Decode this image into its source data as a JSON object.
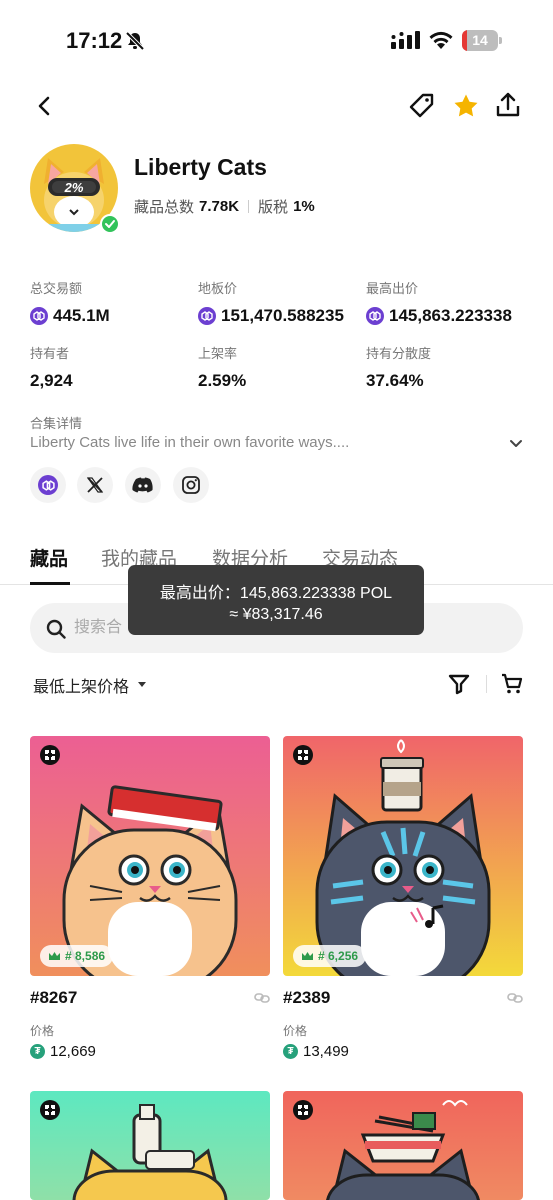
{
  "status_bar": {
    "time": "17:12",
    "battery": "14",
    "battery_level": 0.14
  },
  "collection": {
    "name": "Liberty Cats",
    "items_label": "藏品总数",
    "items_value": "7.78K",
    "royalty_label": "版税",
    "royalty_value": "1%",
    "avatar_text": "2%"
  },
  "stats": [
    {
      "label": "总交易额",
      "value": "445.1M",
      "currency": true
    },
    {
      "label": "地板价",
      "value": "151,470.588235",
      "currency": true
    },
    {
      "label": "最高出价",
      "value": "145,863.223338",
      "currency": true
    },
    {
      "label": "持有者",
      "value": "2,924",
      "currency": false
    },
    {
      "label": "上架率",
      "value": "2.59%",
      "currency": false
    },
    {
      "label": "持有分散度",
      "value": "37.64%",
      "currency": false
    }
  ],
  "details": {
    "label": "合集详情",
    "text": "Liberty Cats live life in their own favorite ways...."
  },
  "tabs": [
    "藏品",
    "我的藏品",
    "数据分析",
    "交易动态"
  ],
  "tooltip": {
    "line1": "最高出价：145,863.223338 POL",
    "line2": "≈ ¥83,317.46"
  },
  "search": {
    "placeholder": "搜索合"
  },
  "sort": {
    "label": "最低上架价格"
  },
  "cards": [
    {
      "title": "#8267",
      "rank": "# 8,586",
      "price_label": "价格",
      "price": "12,669"
    },
    {
      "title": "#2389",
      "rank": "# 6,256",
      "price_label": "价格",
      "price": "13,499"
    }
  ],
  "colors": {
    "accent": "#6c3fd1",
    "star": "#f5b400",
    "rank_green": "#2e9a4a",
    "usdt": "#26a17b"
  }
}
